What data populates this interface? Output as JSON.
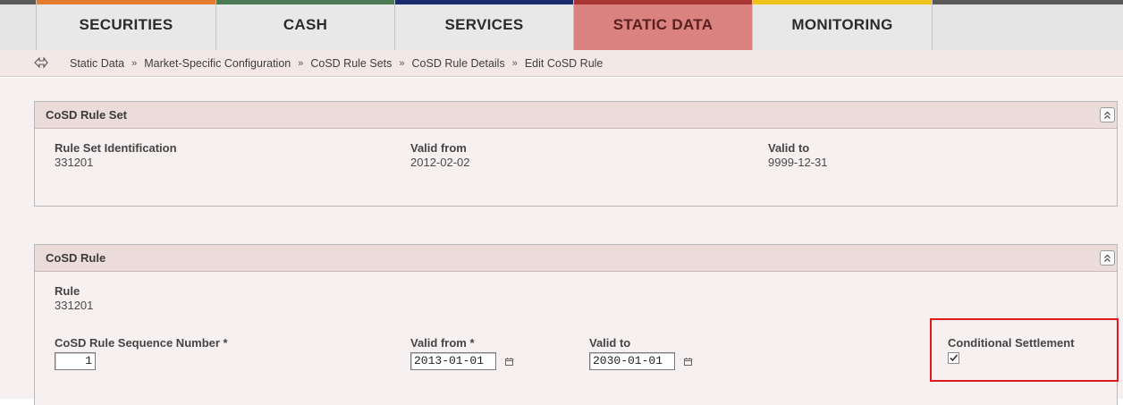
{
  "nav": {
    "tabs": [
      {
        "label": "SECURITIES",
        "color": "#e77b2d"
      },
      {
        "label": "CASH",
        "color": "#4b7a55"
      },
      {
        "label": "SERVICES",
        "color": "#1c2a6e"
      },
      {
        "label": "STATIC DATA",
        "color": "#a83434",
        "active": true
      },
      {
        "label": "MONITORING",
        "color": "#f1c21c"
      }
    ]
  },
  "breadcrumb": {
    "back_icon": "back-arrow-icon",
    "items": [
      "Static Data",
      "Market-Specific Configuration",
      "CoSD Rule Sets",
      "CoSD Rule Details",
      "Edit CoSD Rule"
    ],
    "separator": "»"
  },
  "rule_set_panel": {
    "title": "CoSD Rule Set",
    "rule_set_identification": {
      "label": "Rule Set Identification",
      "value": "331201"
    },
    "valid_from": {
      "label": "Valid from",
      "value": "2012-02-02"
    },
    "valid_to": {
      "label": "Valid to",
      "value": "9999-12-31"
    }
  },
  "rule_panel": {
    "title": "CoSD Rule",
    "rule": {
      "label": "Rule",
      "value": "331201"
    },
    "sequence_number": {
      "label": "CoSD Rule Sequence Number *",
      "value": "1"
    },
    "valid_from": {
      "label": "Valid from *",
      "value": "2013-01-01"
    },
    "valid_to": {
      "label": "Valid to",
      "value": "2030-01-01"
    },
    "conditional_settlement": {
      "label": "Conditional Settlement",
      "checked": true
    }
  },
  "colors": {
    "highlight": "#e0191c",
    "active_tab": "#d9827f"
  }
}
